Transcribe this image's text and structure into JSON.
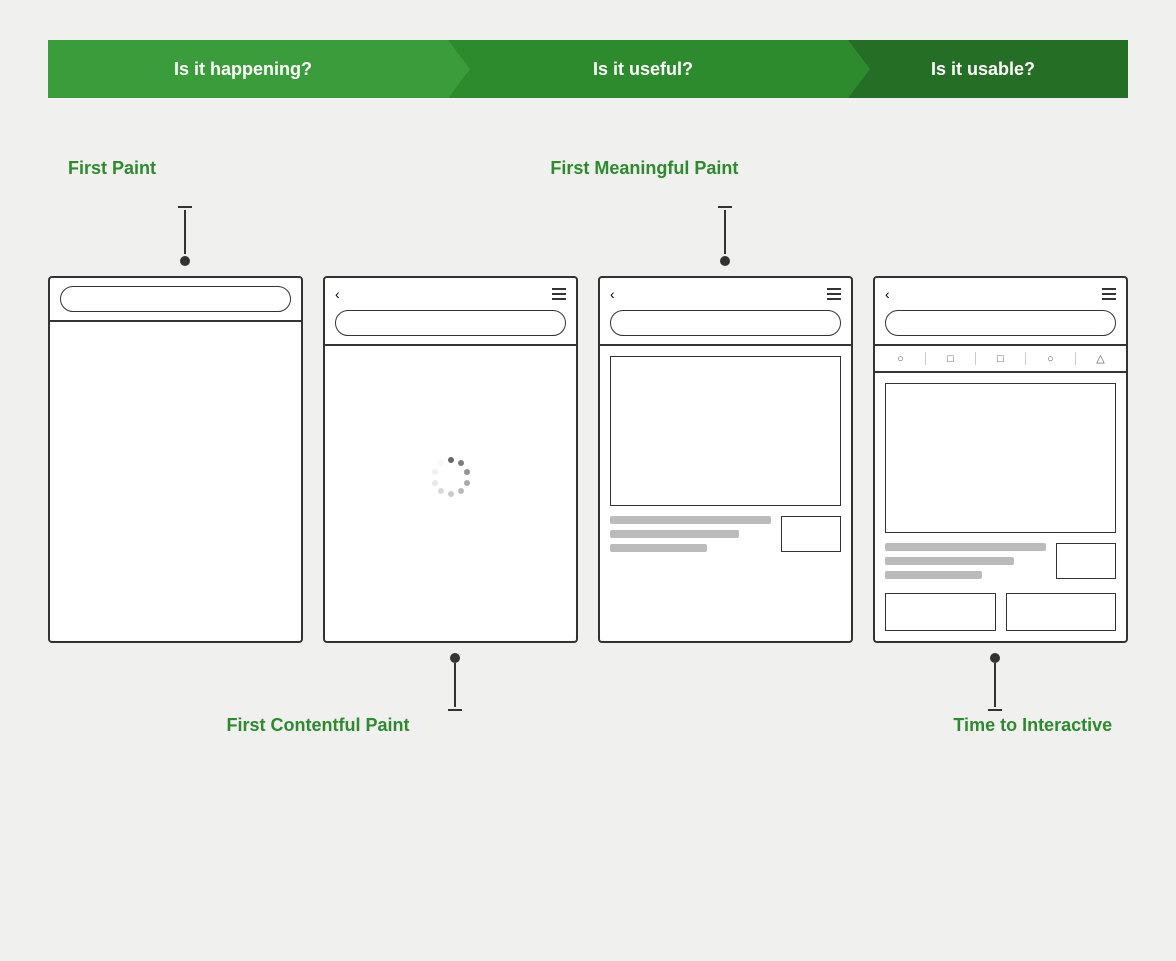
{
  "banner": {
    "arrow1_label": "Is it happening?",
    "arrow2_label": "Is it useful?",
    "arrow3_label": "Is it usable?"
  },
  "labels": {
    "first_paint": "First Paint",
    "first_meaningful_paint": "First Meaningful Paint",
    "first_contentful_paint": "First Contentful Paint",
    "time_to_interactive": "Time to Interactive"
  },
  "phones": [
    {
      "id": "phone1",
      "type": "blank"
    },
    {
      "id": "phone2",
      "type": "loading"
    },
    {
      "id": "phone3",
      "type": "content"
    },
    {
      "id": "phone4",
      "type": "interactive"
    }
  ]
}
